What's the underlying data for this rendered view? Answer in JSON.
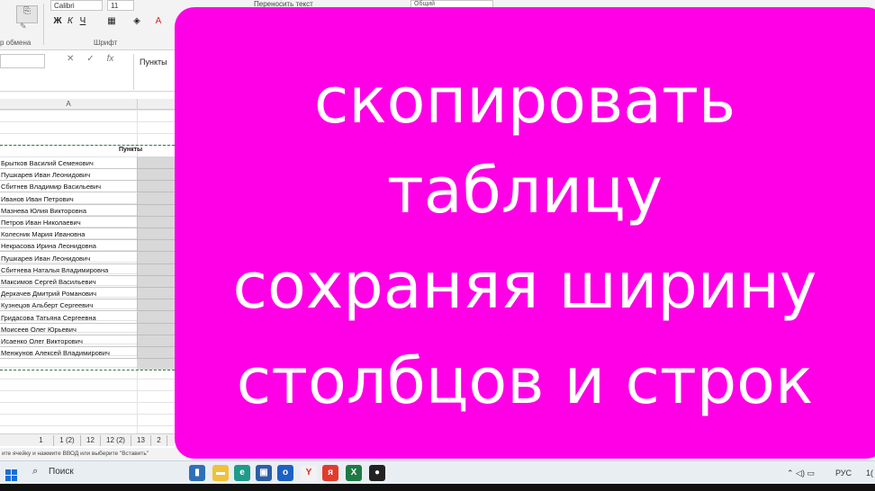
{
  "ribbon": {
    "font_name": "Calibri",
    "font_size": "11",
    "bold": "Ж",
    "italic": "К",
    "underline": "Ч",
    "clipboard_label": "р обмена",
    "font_group_label": "Шрифт",
    "wrap_text": "Перенос́ить текст",
    "number_format": "Общий"
  },
  "formula_bar": {
    "cancel": "✕",
    "confirm": "✓",
    "fx": "fx",
    "value": "Пункты"
  },
  "sheet": {
    "column_a": "A",
    "header": "Пункты",
    "names": [
      "Брытков Василий Семенович",
      "Пушкарев Иван Леонидович",
      "Сбитнев Владимир Васильевич",
      "Иванов Иван Петрович",
      "Мазнева Юлия Викторовна",
      "Петров Иван Николаевич",
      "Колесник Мария Ивановна",
      "Некрасова Ирина Леонидовна",
      "Пушкарев Иван Леонидович",
      "Сбитнева Наталья Владимировна",
      "Максимов Сергей Васильевич",
      "Деркачев Дмитрий Романович",
      "Кузнецов Альберт Сергеевич",
      "Гридасова Татьяна Сергеевна",
      "Моисеев Олег Юрьевич",
      "Исаенко Олег Викторович",
      "Менжунов Алексей Владимирович"
    ],
    "tabs": [
      "1",
      "1 (2)",
      "12",
      "12 (2)",
      "13",
      "2"
    ]
  },
  "status_text": "ите ячейку и нажмите ВВОД или выберите \"Вставить\"",
  "taskbar": {
    "search_label": "Поиск",
    "language": "РУС",
    "time": "1("
  },
  "overlay": {
    "line1": "скопировать",
    "line2": "таблицу",
    "line3": "сохраняя ширину",
    "line4": "столбцов и строк",
    "color": "#ff00e6"
  }
}
